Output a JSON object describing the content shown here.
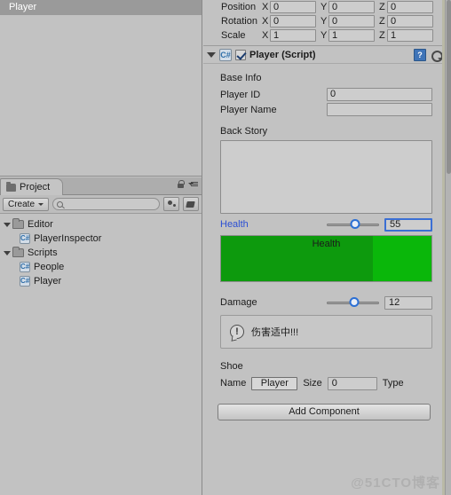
{
  "hierarchy": {
    "selected_object": "Player"
  },
  "project_panel": {
    "tab_label": "Project",
    "tab_icon": "folder-icon",
    "lock_icon": "lock-icon",
    "menu_icon": "hamburger-menu-icon",
    "create_label": "Create",
    "search_placeholder": "",
    "search_value": "",
    "search_icon": "magnifier-icon",
    "filter_by_type_icon": "filter-by-type-icon",
    "filter_by_label_icon": "filter-by-label-icon",
    "tree": [
      {
        "label": "Editor",
        "type": "folder",
        "depth": 0,
        "expanded": true
      },
      {
        "label": "PlayerInspector",
        "type": "csharp-script",
        "depth": 1
      },
      {
        "label": "Scripts",
        "type": "folder",
        "depth": 0,
        "expanded": true
      },
      {
        "label": "People",
        "type": "csharp-script",
        "depth": 1
      },
      {
        "label": "Player",
        "type": "csharp-script",
        "depth": 1
      }
    ]
  },
  "inspector": {
    "transform": {
      "rows": [
        {
          "label": "Position",
          "x": "0",
          "y": "0",
          "z": "0"
        },
        {
          "label": "Rotation",
          "x": "0",
          "y": "0",
          "z": "0"
        },
        {
          "label": "Scale",
          "x": "1",
          "y": "1",
          "z": "1"
        }
      ],
      "axis_x": "X",
      "axis_y": "Y",
      "axis_z": "Z"
    },
    "component": {
      "title": "Player (Script)",
      "enabled": true,
      "foldout_icon": "foldout-open-icon",
      "script_icon": "csharp-script-icon",
      "help_icon": "help-icon",
      "help_glyph": "?",
      "gear_icon": "gear-icon"
    },
    "base_info": {
      "header": "Base Info",
      "player_id_label": "Player ID",
      "player_id_value": "0",
      "player_name_label": "Player Name",
      "player_name_value": ""
    },
    "back_story": {
      "header": "Back Story",
      "value": ""
    },
    "health": {
      "label": "Health",
      "label_color": "#2b4fd4",
      "value": "55",
      "min": 0,
      "max": 100,
      "slider_percent": 55,
      "bar_caption": "Health",
      "bar_fill_color": "#0d9a0d",
      "bar_bg_color": "#0ab70a",
      "bar_fill_percent": 72
    },
    "damage": {
      "label": "Damage",
      "value": "12",
      "slider_percent": 52,
      "warning_icon": "warning-speech-icon",
      "warning_glyph": "!",
      "warning_text": "伤害适中!!!"
    },
    "shoe": {
      "header": "Shoe",
      "name_label": "Name",
      "name_value": "Player",
      "size_label": "Size",
      "size_value": "0",
      "type_label": "Type"
    },
    "add_component_label": "Add Component"
  },
  "watermark": "@51CTO博客"
}
